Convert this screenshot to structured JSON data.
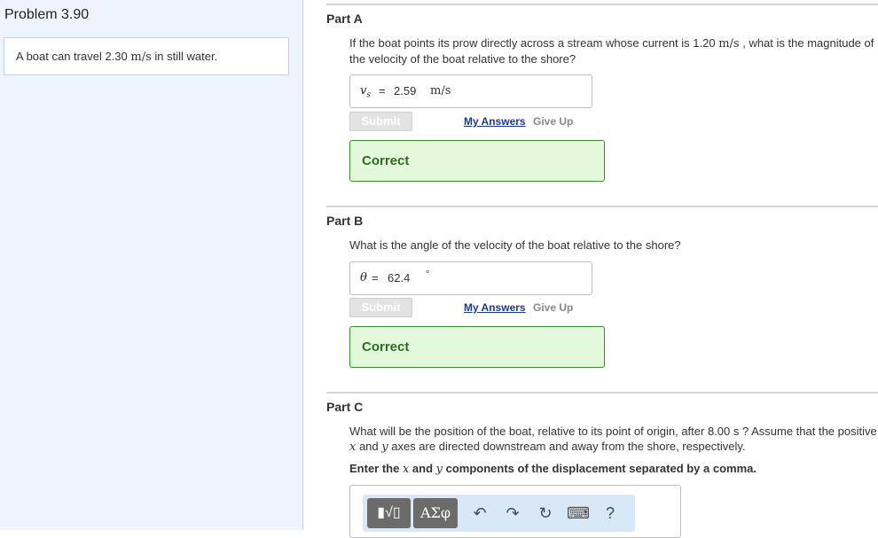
{
  "problem": {
    "title": "Problem 3.90",
    "intro_a": "A boat can travel 2.30",
    "intro_unit": "m/s",
    "intro_b": "in still water."
  },
  "part_a": {
    "label": "Part A",
    "q_line1_a": "If the boat points its prow directly across a stream whose current is 1.20",
    "q_line1_unit": "m/s",
    "q_line1_b": ", what is the magnitude of",
    "q_line2": "the velocity of the boat relative to the shore?",
    "var": "v",
    "var_sub": "s",
    "eq": "=",
    "value": "2.59",
    "unit": "m/s",
    "submit": "Submit",
    "my_answers": "My Answers",
    "give_up": "Give Up",
    "status": "Correct"
  },
  "part_b": {
    "label": "Part B",
    "question": "What is the angle of the velocity of the boat relative to the shore?",
    "var": "θ",
    "eq": "=",
    "value": "62.4",
    "unit": "∘",
    "submit": "Submit",
    "my_answers": "My Answers",
    "give_up": "Give Up",
    "status": "Correct"
  },
  "part_c": {
    "label": "Part C",
    "q_line1": "What will be the position of the boat, relative to its point of origin, after 8.00 s ? Assume that the positive",
    "q_x": "x",
    "q_and": " and ",
    "q_y": "y",
    "q_line2_rest": " axes are directed downstream and away from the shore, respectively.",
    "instr_a": "Enter the ",
    "instr_x": "x",
    "instr_and": " and ",
    "instr_y": "y",
    "instr_b": " components of the displacement separated by a comma.",
    "toolbar": {
      "templates": "▮√▯",
      "symbols": "ΑΣφ",
      "undo": "↶",
      "redo": "↷",
      "reset": "↻",
      "keyboard": "⌨",
      "help": "?"
    }
  }
}
